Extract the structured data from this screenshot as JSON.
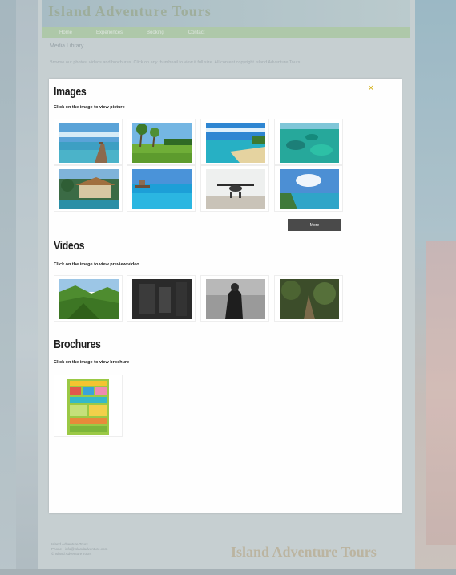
{
  "site": {
    "logo": "Island Adventure Tours",
    "nav": [
      "Home",
      "Experiences",
      "Booking",
      "Contact"
    ],
    "breadcrumb": "Media Library",
    "intro": "Browse our photos, videos and brochures. Click on any thumbnail to view it full size. All content copyright Island Adventure Tours.",
    "footer_lines": [
      "Island Adventure Tours",
      "Phone · info@islandadventure.com",
      "© Island Adventure Tours"
    ],
    "footer_brand": "Island Adventure Tours"
  },
  "modal": {
    "close_icon": "close-icon",
    "images": {
      "title": "Images",
      "subtitle": "Click on the image to view picture",
      "thumbs": [
        {
          "name": "pier-beach",
          "label": "Pier beach"
        },
        {
          "name": "palm-lawn",
          "label": "Palm lawn"
        },
        {
          "name": "sandy-shore",
          "label": "Sandy shore"
        },
        {
          "name": "coral-reef",
          "label": "Coral reef"
        },
        {
          "name": "resort-lodge",
          "label": "Resort lodge"
        },
        {
          "name": "lagoon-dock",
          "label": "Lagoon dock"
        },
        {
          "name": "seaplane",
          "label": "Seaplane"
        },
        {
          "name": "island-coast",
          "label": "Island coast"
        }
      ],
      "more_button": "More"
    },
    "videos": {
      "title": "Videos",
      "subtitle": "Click on the image to view preview video",
      "thumbs": [
        {
          "name": "forest-valley"
        },
        {
          "name": "dark-interior"
        },
        {
          "name": "black-white-figure"
        },
        {
          "name": "jungle-trail"
        }
      ]
    },
    "brochures": {
      "title": "Brochures",
      "subtitle": "Click on the image to view brochure",
      "items": [
        {
          "name": "tour-brochure"
        }
      ]
    }
  },
  "colors": {
    "modal_bg": "#fefefe",
    "more_button_bg": "#4a4a4a",
    "close_icon": "#d4b21b",
    "nav_bar": "#a9c79b"
  }
}
